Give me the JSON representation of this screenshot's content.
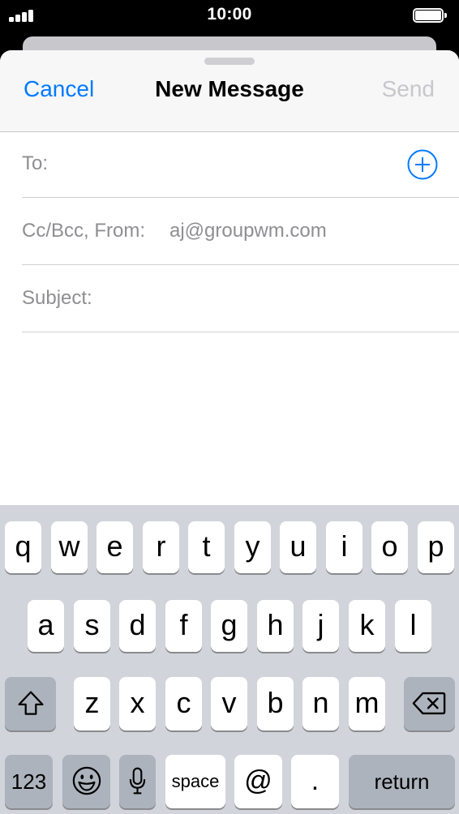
{
  "status_bar": {
    "time": "10:00"
  },
  "compose": {
    "cancel_label": "Cancel",
    "title": "New Message",
    "send_label": "Send",
    "to_label": "To:",
    "cc_label": "Cc/Bcc, From:",
    "from_value": "aj@groupwm.com",
    "subject_label": "Subject:"
  },
  "keyboard": {
    "row1": [
      "q",
      "w",
      "e",
      "r",
      "t",
      "y",
      "u",
      "i",
      "o",
      "p"
    ],
    "row2": [
      "a",
      "s",
      "d",
      "f",
      "g",
      "h",
      "j",
      "k",
      "l"
    ],
    "row3": [
      "z",
      "x",
      "c",
      "v",
      "b",
      "n",
      "m"
    ],
    "numbers_label": "123",
    "space_label": "space",
    "at_label": "@",
    "period_label": ".",
    "return_label": "return"
  },
  "colors": {
    "accent": "#007aff",
    "disabled": "#c7c7cc",
    "placeholder": "#8e8e93",
    "keyboard_bg": "#d1d4da",
    "dark_key": "#acb3bc"
  },
  "icons": {
    "signal": "cellular-signal-icon",
    "battery": "battery-icon",
    "add_contact": "add-contact-icon",
    "shift": "shift-icon",
    "delete": "delete-icon",
    "emoji": "emoji-icon",
    "microphone": "microphone-icon"
  }
}
